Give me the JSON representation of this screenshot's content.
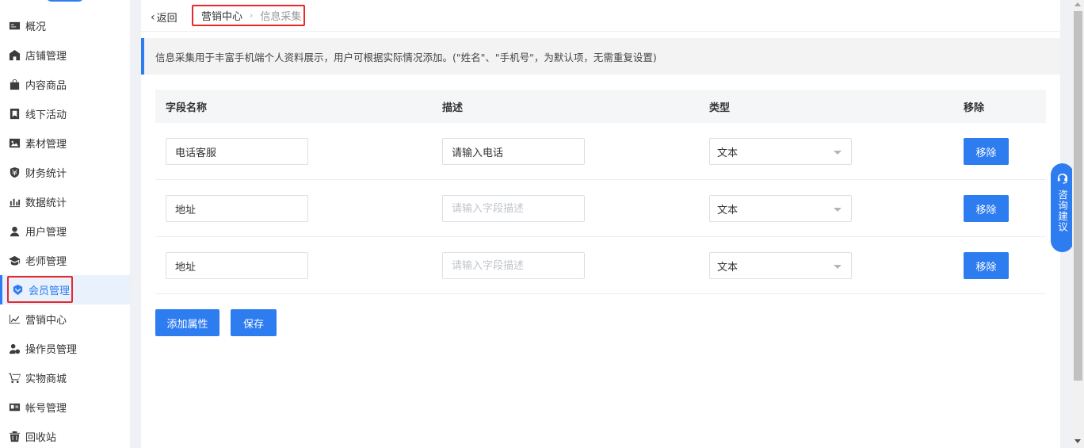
{
  "sidebar": {
    "items": [
      {
        "label": "概况",
        "icon": "overview-icon"
      },
      {
        "label": "店铺管理",
        "icon": "store-icon"
      },
      {
        "label": "内容商品",
        "icon": "bag-icon"
      },
      {
        "label": "线下活动",
        "icon": "flag-icon"
      },
      {
        "label": "素材管理",
        "icon": "image-icon"
      },
      {
        "label": "财务统计",
        "icon": "yuan-shield-icon"
      },
      {
        "label": "数据统计",
        "icon": "bar-chart-icon"
      },
      {
        "label": "用户管理",
        "icon": "user-icon"
      },
      {
        "label": "老师管理",
        "icon": "graduation-cap-icon"
      },
      {
        "label": "会员管理",
        "icon": "member-badge-icon",
        "active": true
      },
      {
        "label": "营销中心",
        "icon": "trend-chart-icon"
      },
      {
        "label": "操作员管理",
        "icon": "operator-icon"
      },
      {
        "label": "实物商城",
        "icon": "cart-icon"
      },
      {
        "label": "帐号管理",
        "icon": "id-card-icon"
      },
      {
        "label": "回收站",
        "icon": "trash-icon"
      }
    ]
  },
  "topbar": {
    "back_label": "返回",
    "breadcrumb": {
      "home": "营销中心",
      "sep": "›",
      "current": "信息采集"
    }
  },
  "notice": "信息采集用于丰富手机端个人资料展示，用户可根据实际情况添加。(\"姓名\"、\"手机号\"，为默认项，无需重复设置)",
  "table": {
    "headers": {
      "name": "字段名称",
      "desc": "描述",
      "type": "类型",
      "remove": "移除"
    },
    "rows": [
      {
        "name": "电话客服",
        "desc": "请输入电话",
        "desc_placeholder": "请输入字段描述",
        "type": "文本",
        "remove_label": "移除"
      },
      {
        "name": "地址",
        "desc": "",
        "desc_placeholder": "请输入字段描述",
        "type": "文本",
        "remove_label": "移除"
      },
      {
        "name": "地址",
        "desc": "",
        "desc_placeholder": "请输入字段描述",
        "type": "文本",
        "remove_label": "移除"
      }
    ]
  },
  "actions": {
    "add_label": "添加属性",
    "save_label": "保存"
  },
  "consult": {
    "label": "咨询建议"
  },
  "colors": {
    "accent": "#2d7cf0",
    "highlight": "#e8282b"
  }
}
